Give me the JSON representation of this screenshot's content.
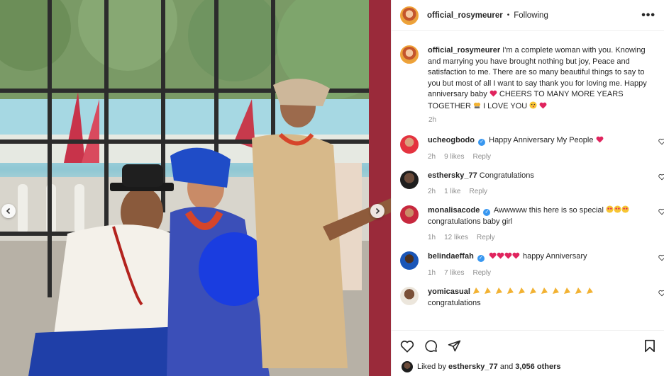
{
  "header": {
    "username": "official_rosymeurer",
    "separator": "•",
    "follow_state": "Following",
    "more_label": "•••"
  },
  "caption": {
    "username": "official_rosymeurer",
    "text": "I'm a complete woman with you. Knowing and marrying you have brought nothing but joy, Peace and satisfaction to me. There are so many beautiful things to say to you but most of all I want to say thank you for loving me. Happy anniversary baby",
    "text_after_heart": "CHEERS TO MANY MORE YEARS TOGETHER",
    "text_end": "I LOVE YOU",
    "time": "2h"
  },
  "comments": [
    {
      "username": "ucheogbodo",
      "verified": true,
      "text": "Happy Anniversary My People",
      "time": "2h",
      "likes": "9 likes",
      "reply": "Reply"
    },
    {
      "username": "esthersky_77",
      "verified": false,
      "text": "Congratulations",
      "time": "2h",
      "likes": "1 like",
      "reply": "Reply"
    },
    {
      "username": "monalisacode",
      "verified": true,
      "text": "Awwwww this here is so special",
      "text2": "congratulations baby girl",
      "time": "1h",
      "likes": "12 likes",
      "reply": "Reply"
    },
    {
      "username": "belindaeffah",
      "verified": true,
      "text": "happy Anniversary",
      "time": "1h",
      "likes": "7 likes",
      "reply": "Reply"
    },
    {
      "username": "yomicasual",
      "verified": false,
      "text": "",
      "text2": "congratulations",
      "time": "",
      "likes": "",
      "reply": ""
    }
  ],
  "footer": {
    "liked_by_prefix": "Liked by",
    "liked_by_user": "esthersky_77",
    "liked_by_mid": "and",
    "liked_by_count": "3,056 others"
  },
  "colors": {
    "heart_red": "#ed4956",
    "verified_blue": "#3897f0",
    "muted_text": "#8e8e8e",
    "border": "#efefef"
  },
  "icons": [
    "chevron-left-icon",
    "chevron-right-icon",
    "heart-icon",
    "comment-icon",
    "share-icon",
    "bookmark-icon",
    "verified-icon",
    "more-icon"
  ]
}
